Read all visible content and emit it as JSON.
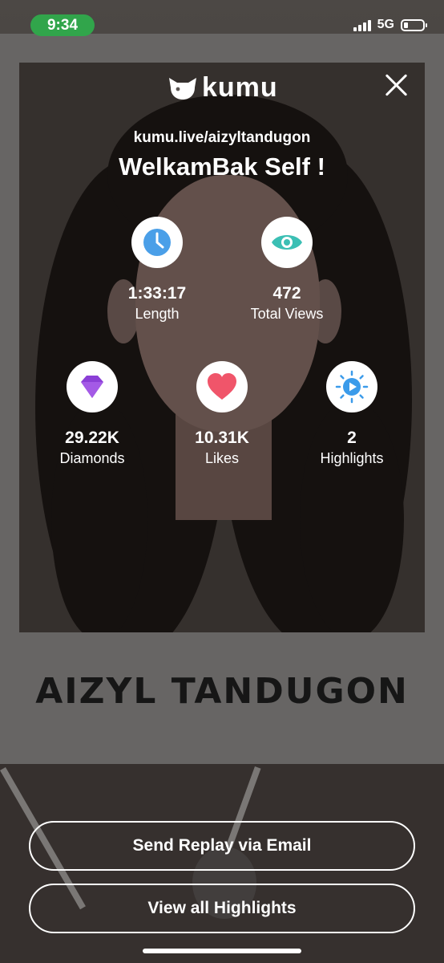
{
  "status_bar": {
    "time": "9:34",
    "network": "5G",
    "time_pill_color": "#31a54b"
  },
  "header": {
    "logo_text": "kumu",
    "logo_icon": "kumu-bear-icon",
    "close_icon": "close-icon"
  },
  "stream": {
    "url": "kumu.live/aizyltandugon",
    "title": "WelkamBak Self !"
  },
  "background": {
    "poster_name": "AIZYL TANDUGON"
  },
  "stats": [
    {
      "value": "1:33:17",
      "label": "Length",
      "icon": "clock-icon",
      "color": "#4a9fe8"
    },
    {
      "value": "472",
      "label": "Total Views",
      "icon": "eye-icon",
      "color": "#3bbfb4"
    },
    {
      "value": "29.22K",
      "label": "Diamonds",
      "icon": "diamond-icon",
      "color": "#8b3fd6"
    },
    {
      "value": "10.31K",
      "label": "Likes",
      "icon": "heart-icon",
      "color": "#f0556a"
    },
    {
      "value": "2",
      "label": "Highlights",
      "icon": "highlight-play-icon",
      "color": "#3b9bea"
    }
  ],
  "actions": {
    "email_button": "Send Replay via Email",
    "highlights_button": "View all Highlights"
  }
}
